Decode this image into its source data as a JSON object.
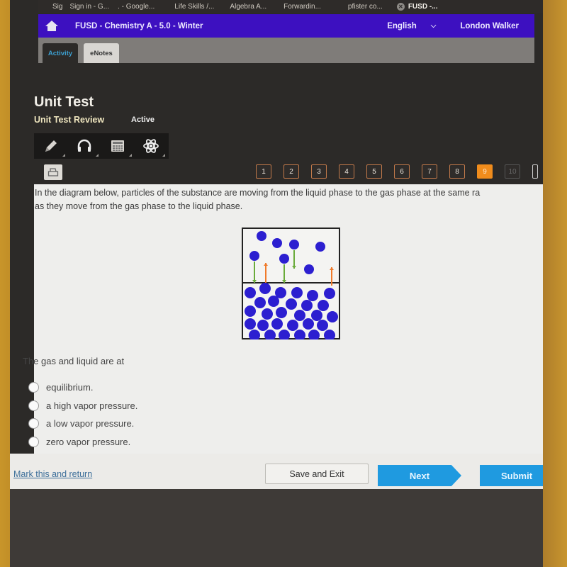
{
  "browser": {
    "tabs": [
      {
        "label": "Sig"
      },
      {
        "label": "Sign in - G..."
      },
      {
        "label": ". - Google..."
      },
      {
        "label": "Life Skills /..."
      },
      {
        "label": "Algebra A..."
      },
      {
        "label": "Forwardin..."
      },
      {
        "label": "pfister co..."
      },
      {
        "label": "FUSD -...",
        "active": true
      }
    ]
  },
  "header": {
    "course_title": "FUSD - Chemistry A - 5.0 - Winter",
    "language": "English",
    "user_name": "London Walker"
  },
  "tabs": [
    {
      "label": "Activity",
      "active": true
    },
    {
      "label": "eNotes"
    }
  ],
  "page": {
    "title": "Unit Test",
    "subtitle": "Unit Test Review",
    "status": "Active"
  },
  "toolbar": {
    "tools": [
      {
        "name": "pencil-icon"
      },
      {
        "name": "headphones-icon"
      },
      {
        "name": "calculator-icon"
      },
      {
        "name": "atom-icon"
      }
    ]
  },
  "question_nav": {
    "current": 9,
    "items": [
      "1",
      "2",
      "3",
      "4",
      "5",
      "6",
      "7",
      "8",
      "9",
      "10"
    ]
  },
  "question": {
    "text_line1": "In the diagram below, particles of the substance are moving from the liquid phase to the gas phase at the same ra",
    "text_line2": "as they move from the gas phase to the liquid phase.",
    "prompt": "The gas and liquid are at",
    "options": [
      "equilibrium.",
      "a high vapor pressure.",
      "a low vapor pressure.",
      "zero vapor pressure."
    ],
    "selected": null
  },
  "diagram": {
    "particle_color": "#2c1fd0",
    "arrow_down_color": "#6aab3a",
    "arrow_up_color": "#f07a2a"
  },
  "footer": {
    "mark_link": "Mark this and return",
    "save_label": "Save and Exit",
    "next_label": "Next",
    "submit_label": "Submit"
  }
}
